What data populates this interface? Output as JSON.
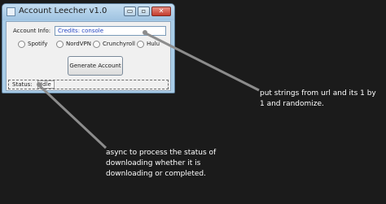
{
  "window": {
    "title": "Account Leecher v1.0",
    "controls": {
      "minimize_glyph": "▭",
      "maximize_glyph": "▫",
      "close_glyph": "✕"
    }
  },
  "form": {
    "account_info_label": "Account Info:",
    "credits_value": "Credits: console",
    "services": [
      {
        "label": "Spotify",
        "selected": false
      },
      {
        "label": "NordVPN",
        "selected": false
      },
      {
        "label": "Crunchyroll",
        "selected": false
      },
      {
        "label": "Hulu",
        "selected": false
      }
    ],
    "generate_button_label": "Generate Account",
    "status_label": "Status:",
    "status_value": "Idle"
  },
  "annotations": {
    "note_1": "put strings from url and its 1 by 1 and randomize.",
    "note_2": "async to process the status of downloading whether it is downloading or completed."
  },
  "colors": {
    "background": "#1b1b1b",
    "window_frame": "#a9cde8",
    "client_area": "#f0f0f0",
    "credits_text": "#1d3fbf",
    "close_button": "#c33b2c",
    "annotation_text": "#ffffff",
    "annotation_arrow": "#8c8c8c"
  }
}
